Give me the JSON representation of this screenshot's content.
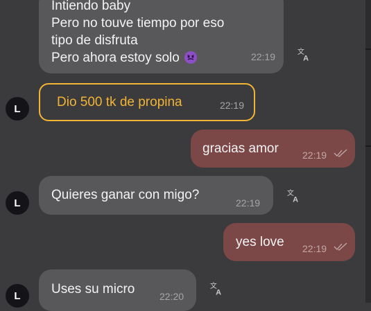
{
  "messages": [
    {
      "type": "incoming",
      "lines": [
        "Intiendo baby",
        "Pero no touve tiempo por eso",
        "tipo de disfruta",
        "Pero ahora estoy solo"
      ],
      "emoji": "devil-emoji",
      "time": "22:19"
    },
    {
      "type": "tip",
      "avatar": "L",
      "text": "Dio 500 tk de propina",
      "time": "22:19"
    },
    {
      "type": "outgoing",
      "text": "gracias amor",
      "time": "22:19",
      "status": "read"
    },
    {
      "type": "incoming",
      "avatar": "L",
      "text": "Quieres ganar con migo?",
      "time": "22:19"
    },
    {
      "type": "outgoing",
      "text": "yes love",
      "time": "22:19",
      "status": "read"
    },
    {
      "type": "incoming",
      "avatar": "L",
      "text": "Uses su micro",
      "time": "22:20"
    }
  ],
  "icons": {
    "translate": "translate-icon",
    "read_receipt": "double-check-icon"
  },
  "colors": {
    "background": "#3b3b3e",
    "incoming_bubble": "#58585b",
    "outgoing_bubble": "#7b4747",
    "tip_accent": "#f2b434",
    "avatar": "#141418"
  }
}
